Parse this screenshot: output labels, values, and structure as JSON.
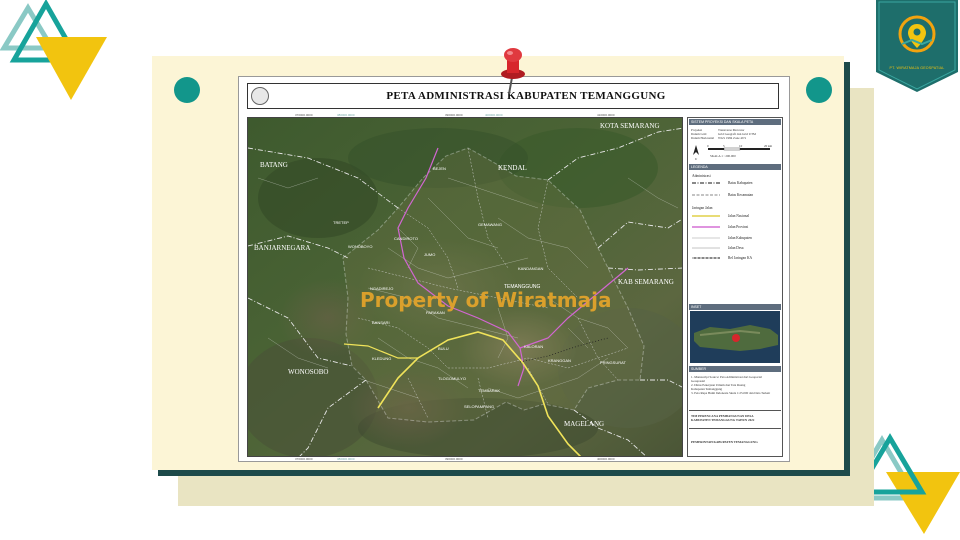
{
  "map": {
    "title": "PETA ADMINISTRASI KABUPATEN TEMANGGUNG",
    "watermark": "Property of Wiratmaja",
    "regions": {
      "kota_semarang": "KOTA SEMARANG",
      "batang": "BATANG",
      "kendal": "KENDAL",
      "banjarnegara": "BANJARNEGARA",
      "kab_semarang": "KAB SEMARANG",
      "wonosobo": "WONOSOBO",
      "magelang": "MAGELANG"
    },
    "districts": {
      "bejen": "BEJEN",
      "tretep": "TRETEP",
      "wonoboyo": "WONOBOYO",
      "candiroto": "CANDIROTO",
      "jumo": "JUMO",
      "gemawang": "GEMAWANG",
      "kandangan": "KANDANGAN",
      "temanggung": "TEMANGGUNG",
      "ngadirejo": "NGADIREJO",
      "parakan": "PARAKAN",
      "bansari": "BANSARI",
      "bulu": "BULU",
      "kledung": "KLEDUNG",
      "tlogomulyo": "TLOGOMULYO",
      "tembarak": "TEMBARAK",
      "selopampang": "SELOPAMPANG",
      "kranggan": "KRANGGAN",
      "pringsurat": "PRINGSURAT",
      "kaloran": "KALORAN"
    },
    "coords_top": [
      "370000.0000",
      "380000.0000",
      "390000.0000",
      "400000.0000",
      "410000.0000"
    ],
    "coords_bottom": [
      "370000.0000",
      "380000.0000",
      "390000.0000",
      "400000.0000"
    ]
  },
  "legend": {
    "sistem_head": "SISTEM PROYEKSI DAN SKALA PETA",
    "sistem_lines": [
      "Proyeksi",
      "Datum Grid",
      "Datum Horizontal"
    ],
    "sistem_values": [
      "Transverse Mercator",
      "Grid Geografi dan Grid UTM",
      "WGS 1984 Zone 49 S"
    ],
    "scale_ticks": [
      "0",
      "5",
      "10",
      "20 km"
    ],
    "scale_text": "SKALA 1 : 200.000",
    "north_label": "U",
    "keterangan_head": "LEGENDA",
    "group_admin": "Administrasi",
    "admin_items": [
      "Batas Kabupaten",
      "Batas Kecamatan"
    ],
    "group_jalan": "Jaringan Jalan",
    "jalan_items": [
      "Jalan Nasional",
      "Jalan Provinsi",
      "Jalan Kabupaten",
      "Jalan Desa",
      "Rel Jaringan KA"
    ],
    "inset_head": "INSET",
    "sumber_head": "SUMBER",
    "sumber_lines": [
      "1. Manuscript Source: Peta Administrasi dari Geoportal",
      "   Geospasial",
      "2. Dinas Pekerjaan Umum dan Tata Ruang",
      "   Kabupaten Temanggung",
      "3. Peta Rupa Bumi Indonesia Skala 1:25.000 dan Data Terkait"
    ],
    "agency_lines": [
      "TIM PERENCANA PEMBANGUNAN DESA",
      "KABUPATEN TEMANGGUNG TAHUN 2022"
    ],
    "footer": "PEMERINTAH KABUPATEN TEMANGGUNG"
  },
  "colors": {
    "teal": "#12968b",
    "yellow": "#f2c40f",
    "navy": "#1d4a4a",
    "board": "#fcf5d6",
    "board_shadow": "#e9e4c2",
    "pin": "#d7262c",
    "road_national": "#f0e35a",
    "road_provincial": "#d060d0"
  },
  "logo_badge": {
    "caption": "PT. WIRATMAJA GEOSPATIAL"
  }
}
